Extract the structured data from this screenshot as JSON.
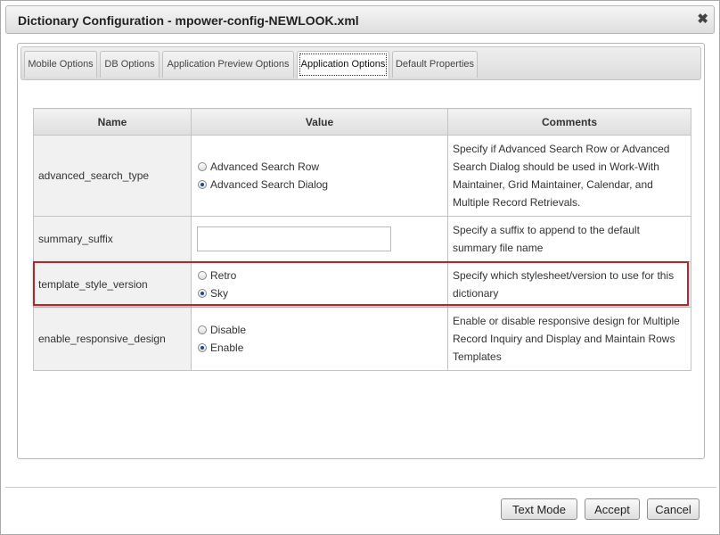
{
  "dialog": {
    "title": "Dictionary Configuration - mpower-config-NEWLOOK.xml",
    "close_glyph": "✖"
  },
  "tabs": [
    {
      "label": "Mobile Options",
      "active": false
    },
    {
      "label": "DB Options",
      "active": false
    },
    {
      "label": "Application Preview Options",
      "active": false
    },
    {
      "label": "Application Options",
      "active": true
    },
    {
      "label": "Default Properties",
      "active": false
    }
  ],
  "table": {
    "headers": {
      "name": "Name",
      "value": "Value",
      "comments": "Comments"
    },
    "rows": [
      {
        "name": "advanced_search_type",
        "options": [
          {
            "label": "Advanced Search Row",
            "checked": false
          },
          {
            "label": "Advanced Search Dialog",
            "checked": true
          }
        ],
        "comment": "Specify if Advanced Search Row or Advanced Search Dialog should be used in Work-With Maintainer, Grid Maintainer, Calendar, and Multiple Record Retrievals."
      },
      {
        "name": "summary_suffix",
        "input_value": "",
        "comment": "Specify a suffix to append to the default summary file name"
      },
      {
        "name": "template_style_version",
        "options": [
          {
            "label": "Retro",
            "checked": false
          },
          {
            "label": "Sky",
            "checked": true
          }
        ],
        "comment": "Specify which stylesheet/version to use for this dictionary"
      },
      {
        "name": "enable_responsive_design",
        "options": [
          {
            "label": "Disable",
            "checked": false
          },
          {
            "label": "Enable",
            "checked": true
          }
        ],
        "comment": "Enable or disable responsive design for Multiple Record Inquiry and Display and Maintain Rows Templates"
      }
    ]
  },
  "buttons": {
    "text_mode": "Text Mode",
    "accept": "Accept",
    "cancel": "Cancel"
  },
  "colors": {
    "highlight_border": "#b2272d",
    "radio_dot": "#1d4a8a"
  }
}
